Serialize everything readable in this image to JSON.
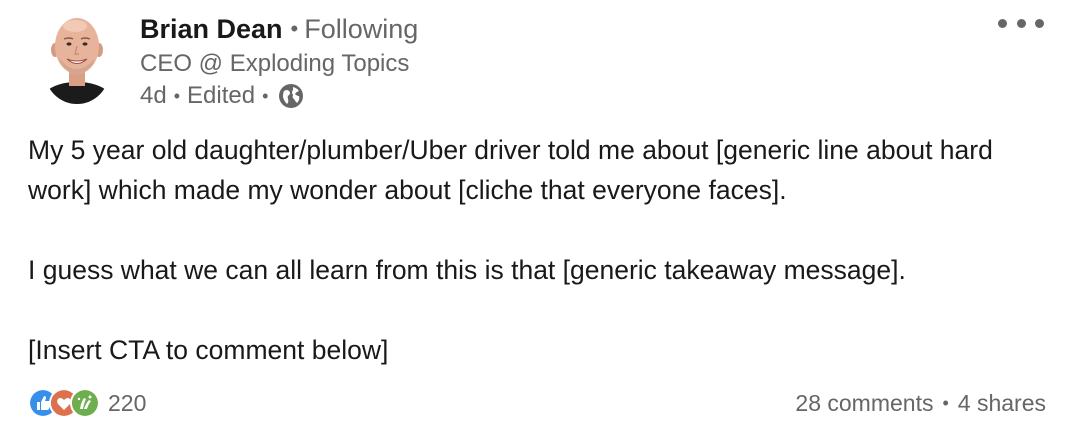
{
  "author": {
    "name": "Brian Dean",
    "follow_status": "Following",
    "headline": "CEO @ Exploding Topics",
    "time": "4d",
    "edited": "Edited",
    "separator": "•"
  },
  "post": {
    "paragraphs": [
      "My 5 year old daughter/plumber/Uber driver told me about [generic line about hard work] which made my wonder about [cliche that everyone faces].",
      "I guess what we can all learn from this is that [generic takeaway message].",
      "[Insert CTA to comment below]"
    ]
  },
  "social": {
    "reactions": [
      "like-icon",
      "love-icon",
      "celebrate-icon"
    ],
    "reaction_count": "220",
    "comments": "28 comments",
    "shares": "4 shares",
    "separator": "•"
  },
  "colors": {
    "primary_text": "#191919",
    "secondary_text": "#666666",
    "like": "#378fe9",
    "love": "#df704d",
    "celebrate": "#6dae4f"
  },
  "icons": {
    "more": "more-horizontal-icon",
    "visibility": "globe-icon"
  }
}
